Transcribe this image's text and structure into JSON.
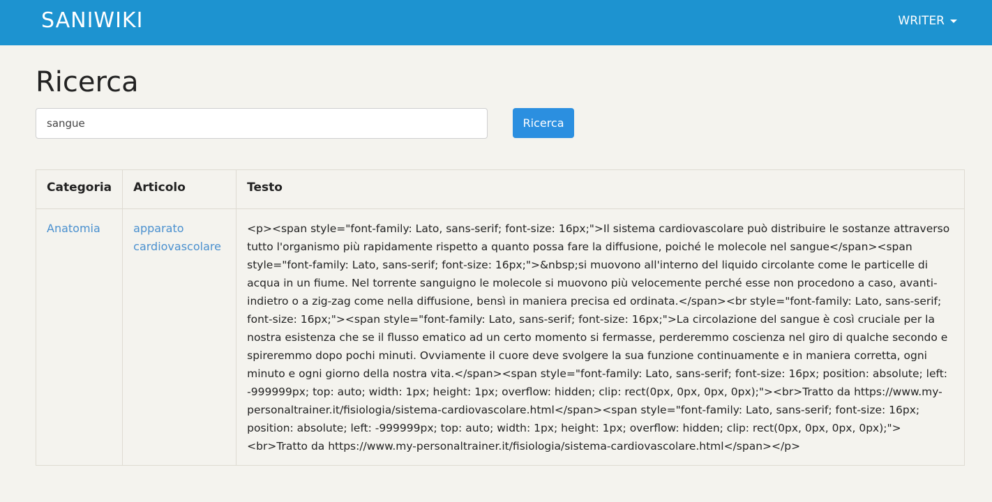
{
  "navbar": {
    "brand": "SANIWIKI",
    "user_menu_label": "WRITER",
    "colors": {
      "background": "#1d93d0",
      "text": "#ffffff"
    }
  },
  "main": {
    "title": "Ricerca",
    "search": {
      "value": "sangue",
      "button_label": "Ricerca"
    }
  },
  "results": {
    "headers": [
      "Categoria",
      "Articolo",
      "Testo"
    ],
    "rows": [
      {
        "categoria": "Anatomia",
        "articolo": "apparato cardiovascolare",
        "testo": "<p><span style=\"font-family: Lato, sans-serif; font-size: 16px;\">Il sistema cardiovascolare può distribuire le sostanze attraverso tutto l'organismo più rapidamente rispetto a quanto possa fare la diffusione, poiché le molecole nel sangue</span><span style=\"font-family: Lato, sans-serif; font-size: 16px;\">&nbsp;si muovono all'interno del liquido circolante come le particelle di acqua in un fiume. Nel torrente sanguigno le molecole si muovono più velocemente perché esse non procedono a caso, avanti-indietro o a zig-zag come nella diffusione, bensì in maniera precisa ed ordinata.</span><br style=\"font-family: Lato, sans-serif; font-size: 16px;\"><span style=\"font-family: Lato, sans-serif; font-size: 16px;\">La circolazione del sangue è così cruciale per la nostra esistenza che se il flusso ematico ad un certo momento si fermasse, perderemmo coscienza nel giro di qualche secondo e spireremmo dopo pochi minuti. Ovviamente il cuore deve svolgere la sua funzione continuamente e in maniera corretta, ogni minuto e ogni giorno della nostra vita.</span><span style=\"font-family: Lato, sans-serif; font-size: 16px; position: absolute; left: -999999px; top: auto; width: 1px; height: 1px; overflow: hidden; clip: rect(0px, 0px, 0px, 0px);\"><br>Tratto da https://www.my-personaltrainer.it/fisiologia/sistema-cardiovascolare.html</span><span style=\"font-family: Lato, sans-serif; font-size: 16px; position: absolute; left: -999999px; top: auto; width: 1px; height: 1px; overflow: hidden; clip: rect(0px, 0px, 0px, 0px);\"><br>Tratto da https://www.my-personaltrainer.it/fisiologia/sistema-cardiovascolare.html</span></p>"
      }
    ],
    "colors": {
      "link": "#4a90cf",
      "border": "#dedbd2"
    }
  }
}
